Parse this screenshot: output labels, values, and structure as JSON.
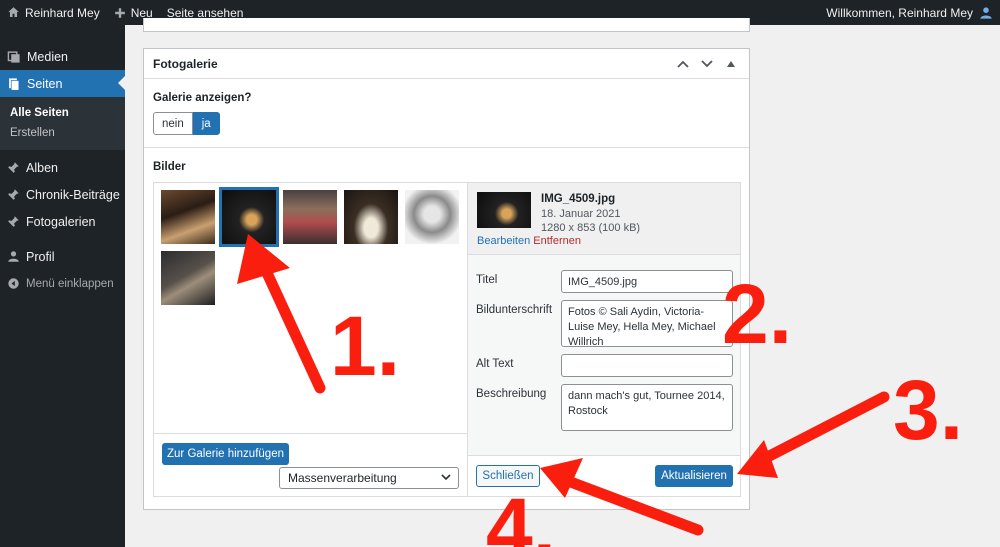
{
  "adminbar": {
    "site_name": "Reinhard Mey",
    "new_label": "Neu",
    "view_label": "Seite ansehen",
    "welcome": "Willkommen, Reinhard Mey"
  },
  "sidebar": {
    "items": [
      {
        "label": "Medien"
      },
      {
        "label": "Seiten"
      },
      {
        "label": "Alben"
      },
      {
        "label": "Chronik-Beiträge"
      },
      {
        "label": "Fotogalerien"
      },
      {
        "label": "Profil"
      },
      {
        "label": "Menü einklappen"
      }
    ],
    "submenu": [
      "Alle Seiten",
      "Erstellen"
    ]
  },
  "postbox": {
    "title": "Fotogalerie",
    "show_gallery_label": "Galerie anzeigen?",
    "toggle_no": "nein",
    "toggle_yes": "ja",
    "images_label": "Bilder"
  },
  "gallery": {
    "add_button": "Zur Galerie hinzufügen",
    "bulk_select": "Massenverarbeitung"
  },
  "attachment": {
    "filename": "IMG_4509.jpg",
    "date": "18. Januar 2021",
    "dimensions": "1280 x 853 (100 kB)",
    "edit_link": "Bearbeiten",
    "remove_link": "Entfernen",
    "title_label": "Titel",
    "title_value": "IMG_4509.jpg",
    "caption_label": "Bildunterschrift",
    "caption_value": "Fotos © Sali Aydin, Victoria-Luise Mey, Hella Mey, Michael Willrich",
    "alt_label": "Alt Text",
    "alt_value": "",
    "description_label": "Beschreibung",
    "description_value": "dann mach's gut, Tournee 2014, Rostock",
    "close_button": "Schließen",
    "update_button": "Aktualisieren"
  },
  "annotations": [
    "1.",
    "2.",
    "3.",
    "4."
  ],
  "colors": {
    "accent": "#2271b1",
    "annotation": "#fa1e0e",
    "sidebar": "#1d2327"
  }
}
